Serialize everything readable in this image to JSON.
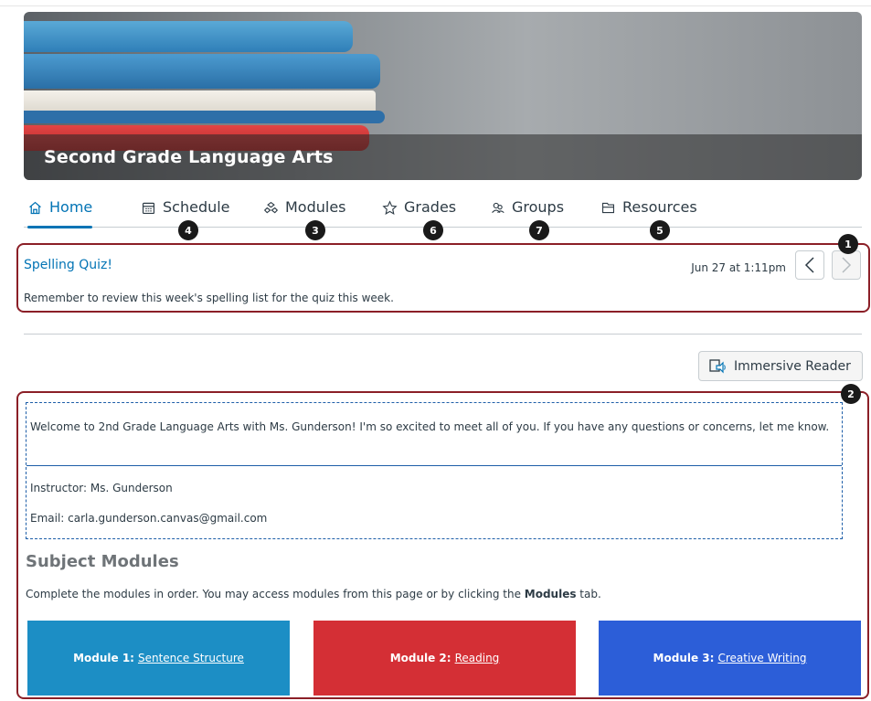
{
  "course": {
    "title": "Second Grade Language Arts"
  },
  "tabs": [
    {
      "label": "Home",
      "icon": "home-icon"
    },
    {
      "label": "Schedule",
      "icon": "calendar-icon",
      "badge": "4"
    },
    {
      "label": "Modules",
      "icon": "modules-icon",
      "badge": "3"
    },
    {
      "label": "Grades",
      "icon": "star-icon",
      "badge": "6"
    },
    {
      "label": "Groups",
      "icon": "groups-icon",
      "badge": "7"
    },
    {
      "label": "Resources",
      "icon": "resources-icon",
      "badge": "5"
    }
  ],
  "announcement": {
    "title": "Spelling Quiz!",
    "date": "Jun 27 at 1:11pm",
    "body": "Remember to review this week's spelling list for the quiz this week.",
    "badge": "1"
  },
  "immersive_reader": {
    "label": "Immersive Reader"
  },
  "content": {
    "badge": "2",
    "welcome": "Welcome to 2nd Grade Language Arts with Ms. Gunderson! I'm so excited to meet all of you. If you have any questions or concerns, let me know.",
    "instructor": "Instructor: Ms. Gunderson",
    "email": "Email: carla.gunderson.canvas@gmail.com",
    "subject_title": "Subject Modules",
    "subject_desc_before": "Complete the modules in order. You may access modules from this page or by clicking the ",
    "subject_desc_bold": "Modules",
    "subject_desc_after": " tab.",
    "modules": [
      {
        "prefix": "Module 1:",
        "link": "Sentence Structure",
        "color": "#1c8ec5"
      },
      {
        "prefix": "Module 2:",
        "link": "Reading",
        "color": "#d42f35"
      },
      {
        "prefix": "Module 3:",
        "link": "Creative Writing",
        "color": "#2c5ed8"
      }
    ]
  },
  "colors": {
    "accent": "#0374b5",
    "highlight_border": "#8b1f27"
  }
}
